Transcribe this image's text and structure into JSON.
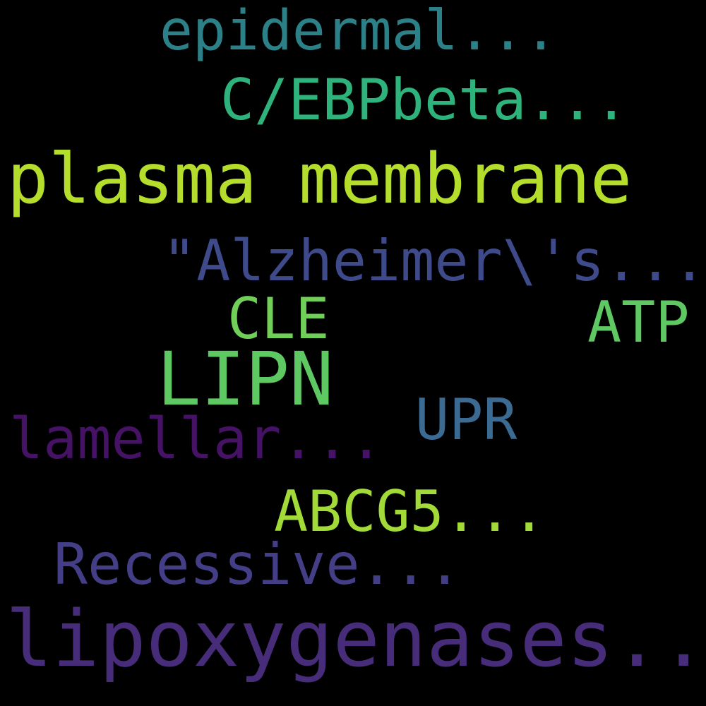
{
  "background": "#000000",
  "words": {
    "epidermal": {
      "text": "epidermal...",
      "color": "#2c8189"
    },
    "cebp": {
      "text": "C/EBPbeta...",
      "color": "#2db37b"
    },
    "plasma": {
      "text": "plasma membrane",
      "color": "#b4dd2c"
    },
    "alzheimer": {
      "text": "\"Alzheimer\\'s...",
      "color": "#3e4a89"
    },
    "cle": {
      "text": "CLE",
      "color": "#70cf57"
    },
    "atp": {
      "text": "ATP",
      "color": "#5ec962"
    },
    "lipn": {
      "text": "LIPN",
      "color": "#5ec962"
    },
    "upr": {
      "text": "UPR",
      "color": "#3b6a93"
    },
    "lamellar": {
      "text": "lamellar...",
      "color": "#461265"
    },
    "abcg5": {
      "text": "ABCG5...",
      "color": "#a2da37"
    },
    "recessive": {
      "text": "Recessive...",
      "color": "#433e85"
    },
    "lipoxy": {
      "text": "lipoxygenases...",
      "color": "#472c7a"
    }
  }
}
